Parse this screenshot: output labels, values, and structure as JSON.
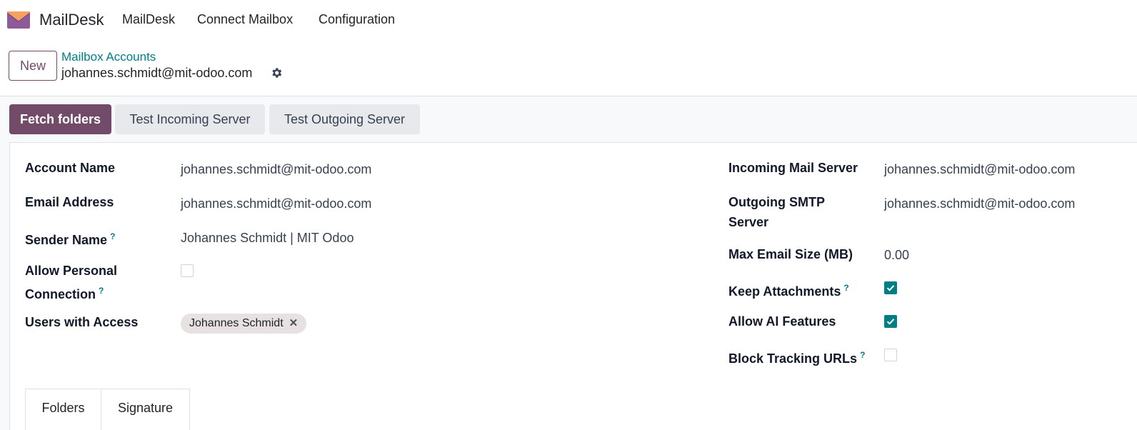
{
  "app": {
    "brand": "MailDesk"
  },
  "nav": {
    "items": [
      "MailDesk",
      "Connect Mailbox",
      "Configuration"
    ]
  },
  "control": {
    "new_label": "New",
    "breadcrumb_parent": "Mailbox Accounts",
    "breadcrumb_current": "johannes.schmidt@mit-odoo.com"
  },
  "actions": {
    "fetch_folders": "Fetch folders",
    "test_incoming": "Test Incoming Server",
    "test_outgoing": "Test Outgoing Server"
  },
  "form": {
    "left": {
      "account_name": {
        "label": "Account Name",
        "value": "johannes.schmidt@mit-odoo.com"
      },
      "email_address": {
        "label": "Email Address",
        "value": "johannes.schmidt@mit-odoo.com"
      },
      "sender_name": {
        "label": "Sender Name",
        "help": "?",
        "value": "Johannes Schmidt | MIT Odoo"
      },
      "allow_personal": {
        "label_line1": "Allow Personal",
        "label_line2": "Connection",
        "help": "?",
        "checked": false
      },
      "users_access": {
        "label": "Users with Access",
        "tags": [
          "Johannes Schmidt"
        ],
        "remove_glyph": "✕"
      }
    },
    "right": {
      "incoming_server": {
        "label": "Incoming Mail Server",
        "value": "johannes.schmidt@mit-odoo.com"
      },
      "outgoing_server": {
        "label_line1": "Outgoing SMTP",
        "label_line2": "Server",
        "value": "johannes.schmidt@mit-odoo.com"
      },
      "max_size": {
        "label": "Max Email Size (MB)",
        "value": "0.00"
      },
      "keep_attachments": {
        "label": "Keep Attachments",
        "help": "?",
        "checked": true
      },
      "allow_ai": {
        "label": "Allow AI Features",
        "checked": true
      },
      "block_tracking": {
        "label": "Block Tracking URLs",
        "help": "?",
        "checked": false
      }
    }
  },
  "tabs": [
    {
      "label": "Folders",
      "active": true
    },
    {
      "label": "Signature",
      "active": false
    }
  ],
  "colors": {
    "brand": "#714b67",
    "accent": "#017e84",
    "logo_purple": "#8d5b97",
    "logo_orange": "#f4a261"
  },
  "icons": {
    "logo": "envelope-logo-icon",
    "settings": "gear-icon",
    "check": "check-icon",
    "remove": "close-icon"
  }
}
